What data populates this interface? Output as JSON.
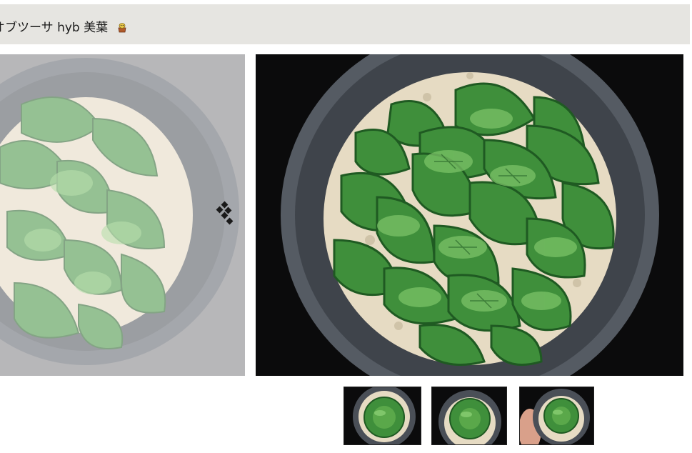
{
  "header": {
    "title": "オブツーサ hyb 美葉",
    "title_icon": "plant-pot-emoji-icon"
  },
  "gallery": {
    "prev_arrow_icon": "chevron-left-icon",
    "colors": {
      "pot": "#4a5059",
      "soil": "#e8dcc4",
      "leaf": "#3f8f3b",
      "leaf_dark": "#1f5a22",
      "leaf_light": "#7fc66a"
    },
    "main_image": "succulent-haworthia-main-photo",
    "prev_image": "succulent-haworthia-previous-photo",
    "thumbnails": [
      {
        "name": "thumbnail-1"
      },
      {
        "name": "thumbnail-2"
      },
      {
        "name": "thumbnail-3"
      }
    ]
  }
}
